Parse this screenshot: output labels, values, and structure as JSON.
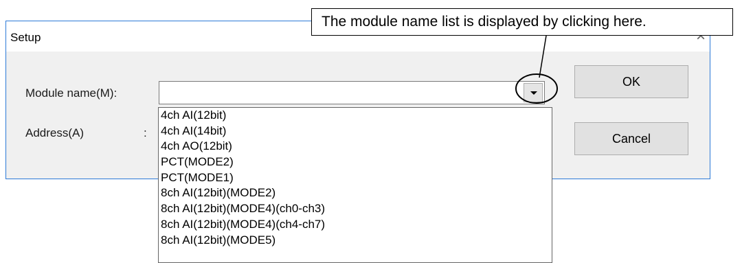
{
  "dialog": {
    "title": "Setup",
    "close_symbol": "×"
  },
  "form": {
    "module_label": "Module name(M):",
    "module_value": "",
    "address_label": "Address(A)",
    "address_colon": ":"
  },
  "buttons": {
    "ok": "OK",
    "cancel": "Cancel"
  },
  "dropdown": {
    "items": [
      "4ch AI(12bit)",
      "4ch AI(14bit)",
      "4ch AO(12bit)",
      "PCT(MODE2)",
      "PCT(MODE1)",
      "8ch AI(12bit)(MODE2)",
      "8ch AI(12bit)(MODE4)(ch0-ch3)",
      "8ch AI(12bit)(MODE4)(ch4-ch7)",
      "8ch AI(12bit)(MODE5)"
    ]
  },
  "callout": {
    "text": "The module name list is displayed by clicking here."
  },
  "colors": {
    "window_border": "#2b79d7",
    "dialog_bg": "#f0f0f0",
    "button_bg": "#e1e1e1"
  }
}
